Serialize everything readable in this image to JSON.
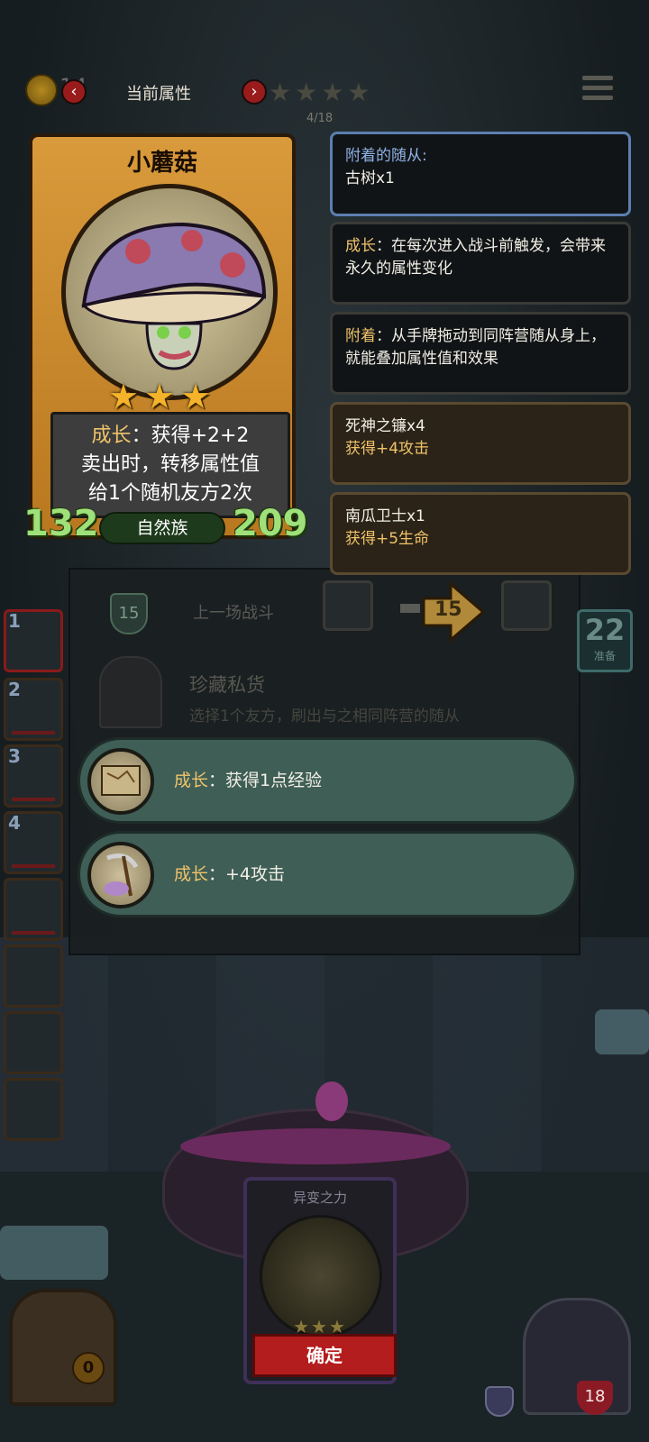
{
  "top_bar": {
    "coin_count": "14",
    "panel_title": "当前属性",
    "stars": "★★★★",
    "progress": "4/18"
  },
  "card": {
    "name": "小蘑菇",
    "stars": "★★★",
    "ability_keyword": "成长",
    "ability_line1_rest": "：获得+2+2",
    "ability_line2": "卖出时，转移属性值",
    "ability_line3": "给1个随机友方2次",
    "attack": "132",
    "health": "209",
    "tribe": "自然族"
  },
  "info_panels": {
    "attached_title": "附着的随从:",
    "attached_value": "古树x1",
    "growth_keyword": "成长",
    "growth_desc": "：在每次进入战斗前触发，会带来永久的属性变化",
    "attach_keyword": "附着",
    "attach_desc": "：从手牌拖动到同阵营随从身上，就能叠加属性值和效果",
    "item1_name": "死神之镰x4",
    "item1_effect": "获得+4攻击",
    "item2_name": "南瓜卫士x1",
    "item2_effect": "获得+5生命"
  },
  "background_panel": {
    "shield_value": "15",
    "last_battle_label": "上一场战斗",
    "arrow_value": "15",
    "prep_value": "22",
    "prep_label": "准备",
    "treasure_title": "珍藏私货",
    "treasure_desc": "选择1个友方，刷出与之相同阵营的随从"
  },
  "options": [
    {
      "keyword": "成长",
      "text": "：获得1点经验",
      "icon": "map-scroll-icon"
    },
    {
      "keyword": "成长",
      "text": "：+4攻击",
      "icon": "scythe-icon"
    }
  ],
  "roster": [
    "1",
    "2",
    "3",
    "4"
  ],
  "bottom_card": {
    "title": "异变之力",
    "stars": "★★★",
    "confirm_label": "确定"
  },
  "bottom": {
    "chest_count": "0",
    "hero_hp": "18"
  },
  "colors": {
    "keyword": "#f0c36a",
    "stat_green": "#9fe07a",
    "confirm_red": "#b41d1d",
    "option_teal": "#3e5e56"
  }
}
